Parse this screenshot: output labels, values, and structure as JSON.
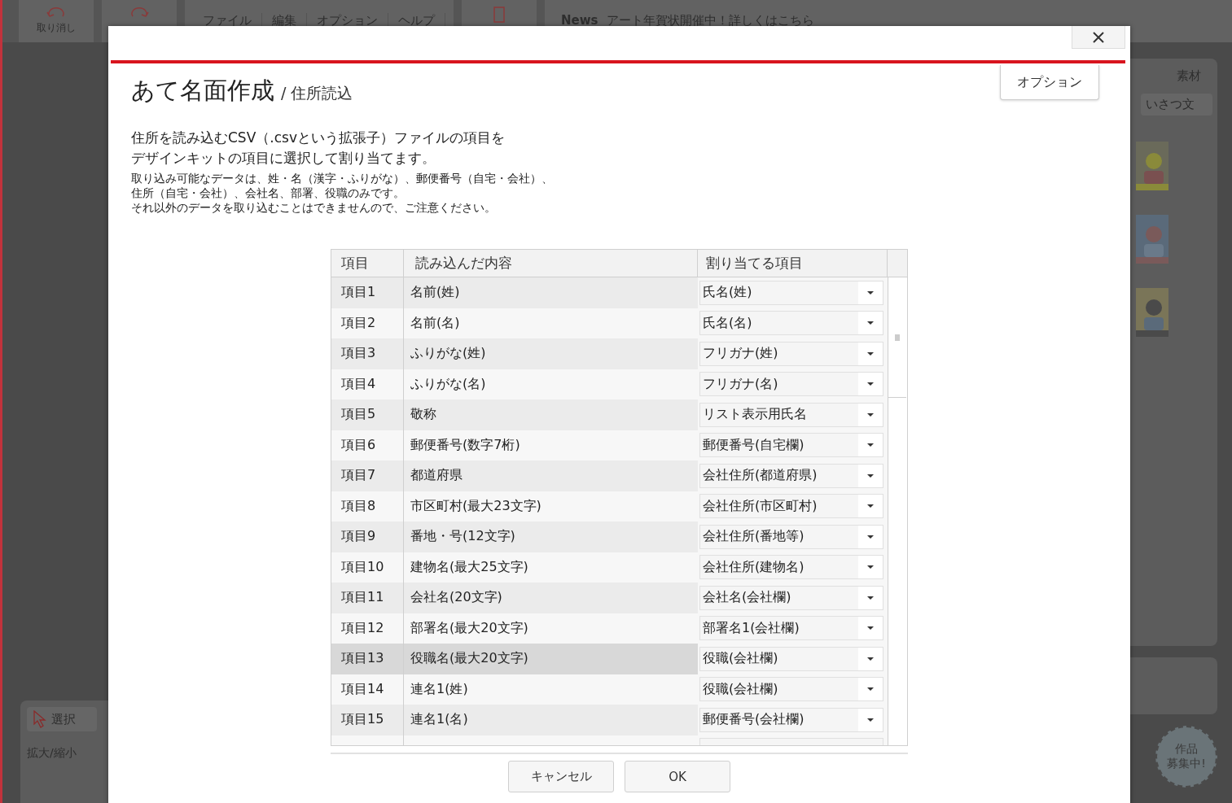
{
  "app": {
    "toolbar": {
      "undo_label": "取り消し",
      "menus": [
        "ファイル",
        "編集",
        "オプション",
        "ヘルプ"
      ],
      "news_label": "News",
      "news_text": "アート年賀状開催中！詳しくはこちら"
    },
    "left_panel": {
      "tool_label": "選択",
      "zoom_label": "拡大/縮小"
    },
    "right_panel": {
      "tab_label": "素材",
      "field_text": "いさつ文",
      "badge_lines": [
        "作品",
        "募集中!"
      ]
    }
  },
  "dialog": {
    "title": "あて名面作成",
    "subtitle": "/ 住所読込",
    "options_button": "オプション",
    "intro_lines": [
      "住所を読み込むCSV（.csvという拡張子）ファイルの項目を",
      "デザインキットの項目に選択して割り当てます。"
    ],
    "note_lines": [
      "取り込み可能なデータは、姓・名（漢字・ふりがな）、郵便番号（自宅・会社）、",
      "住所（自宅・会社）、会社名、部署、役職のみです。",
      "それ以外のデータを取り込むことはできませんので、ご注意ください。"
    ],
    "table": {
      "columns": [
        "項目",
        "読み込んだ内容",
        "割り当てる項目"
      ],
      "rows": [
        {
          "item": "項目1",
          "content": "名前(姓)",
          "assigned": "氏名(姓)",
          "selected": false
        },
        {
          "item": "項目2",
          "content": "名前(名)",
          "assigned": "氏名(名)",
          "selected": false
        },
        {
          "item": "項目3",
          "content": "ふりがな(姓)",
          "assigned": "フリガナ(姓)",
          "selected": false
        },
        {
          "item": "項目4",
          "content": "ふりがな(名)",
          "assigned": "フリガナ(名)",
          "selected": false
        },
        {
          "item": "項目5",
          "content": "敬称",
          "assigned": "リスト表示用氏名",
          "selected": false
        },
        {
          "item": "項目6",
          "content": "郵便番号(数字7桁)",
          "assigned": "郵便番号(自宅欄)",
          "selected": false
        },
        {
          "item": "項目7",
          "content": "都道府県",
          "assigned": "会社住所(都道府県)",
          "selected": false
        },
        {
          "item": "項目8",
          "content": "市区町村(最大23文字)",
          "assigned": "会社住所(市区町村)",
          "selected": false
        },
        {
          "item": "項目9",
          "content": "番地・号(12文字)",
          "assigned": "会社住所(番地等)",
          "selected": false
        },
        {
          "item": "項目10",
          "content": "建物名(最大25文字)",
          "assigned": "会社住所(建物名)",
          "selected": false
        },
        {
          "item": "項目11",
          "content": "会社名(20文字)",
          "assigned": "会社名(会社欄)",
          "selected": false
        },
        {
          "item": "項目12",
          "content": "部署名(最大20文字)",
          "assigned": "部署名1(会社欄)",
          "selected": false
        },
        {
          "item": "項目13",
          "content": "役職名(最大20文字)",
          "assigned": "役職(会社欄)",
          "selected": true
        },
        {
          "item": "項目14",
          "content": "連名1(姓)",
          "assigned": "役職(会社欄)",
          "selected": false
        },
        {
          "item": "項目15",
          "content": "連名1(名)",
          "assigned": "郵便番号(会社欄)",
          "selected": false
        }
      ]
    },
    "buttons": [
      "キャンセル",
      "OK"
    ]
  }
}
